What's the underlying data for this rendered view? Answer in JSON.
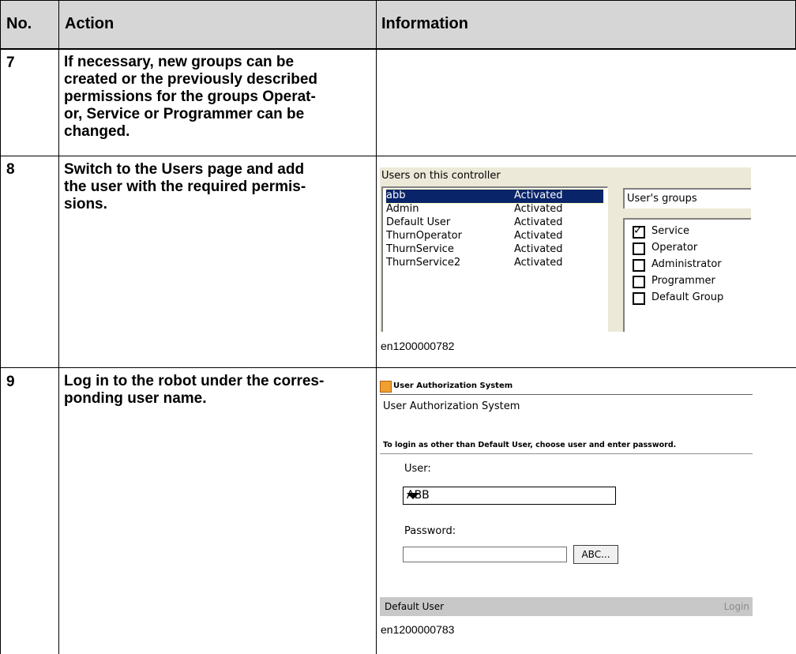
{
  "headers": {
    "no": "No.",
    "action": "Action",
    "information": "Information"
  },
  "rows": [
    {
      "no": "7",
      "action_lines": [
        [
          {
            "t": "If necessary, new groups can be"
          }
        ],
        [
          {
            "t": "created or the previously described"
          }
        ],
        [
          {
            "t": "permissions for the groups "
          },
          {
            "t": "Operat-",
            "b": true
          }
        ],
        [
          {
            "t": "or",
            "b": true
          },
          {
            "t": ", "
          },
          {
            "t": "Service",
            "b": true
          },
          {
            "t": " or "
          },
          {
            "t": "Programmer",
            "b": true
          },
          {
            "t": " can be"
          }
        ],
        [
          {
            "t": "changed."
          }
        ]
      ]
    },
    {
      "no": "8",
      "action_lines": [
        [
          {
            "t": "Switch to the "
          },
          {
            "t": "Users",
            "b": true
          },
          {
            "t": " page and add"
          }
        ],
        [
          {
            "t": "the user with the required permis-"
          }
        ],
        [
          {
            "t": "sions."
          }
        ]
      ],
      "caption": "en1200000782"
    },
    {
      "no": "9",
      "action_lines": [
        [
          {
            "t": "Log in to the robot under the corres-"
          }
        ],
        [
          {
            "t": "ponding user name."
          }
        ]
      ],
      "caption": "en1200000783"
    }
  ],
  "users_panel": {
    "title": "Users on this controller",
    "users": [
      {
        "name": "abb",
        "status": "Activated",
        "selected": true
      },
      {
        "name": "Admin",
        "status": "Activated"
      },
      {
        "name": "Default User",
        "status": "Activated"
      },
      {
        "name": "ThurnOperator",
        "status": "Activated"
      },
      {
        "name": "ThurnService",
        "status": "Activated"
      },
      {
        "name": "ThurnService2",
        "status": "Activated"
      }
    ],
    "groups_label": "User's groups",
    "groups": [
      {
        "name": "Service",
        "checked": true
      },
      {
        "name": "Operator",
        "checked": false
      },
      {
        "name": "Administrator",
        "checked": false
      },
      {
        "name": "Programmer",
        "checked": false
      },
      {
        "name": "Default Group",
        "checked": false
      }
    ]
  },
  "login_dialog": {
    "window_title": "User Authorization System",
    "heading": "User Authorization System",
    "instruction": "To login as other than Default User, choose user and enter password.",
    "user_label": "User:",
    "user_value": "ABB",
    "password_label": "Password:",
    "password_value": "",
    "abc_button": "ABC...",
    "current_user": "Default User",
    "login_button": "Login"
  }
}
